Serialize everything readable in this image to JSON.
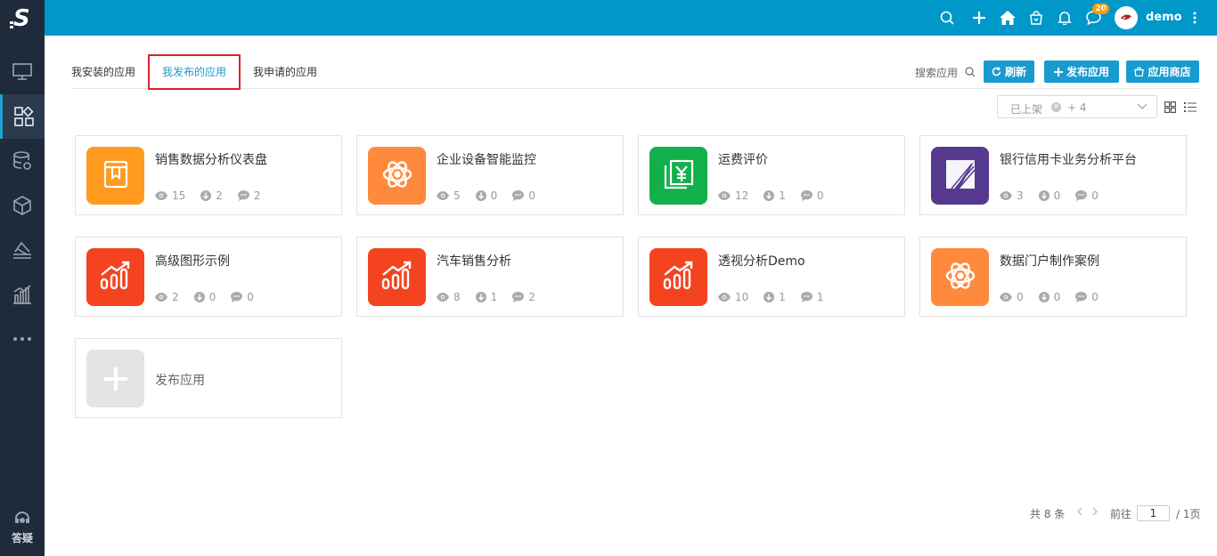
{
  "sidebar": {
    "logo": "S",
    "items": [
      {
        "name": "monitor-icon",
        "active": false
      },
      {
        "name": "apps-icon",
        "active": true
      },
      {
        "name": "database-settings-icon",
        "active": false
      },
      {
        "name": "cube-icon",
        "active": false
      },
      {
        "name": "layers-icon",
        "active": false
      },
      {
        "name": "bar-chart-icon",
        "active": false
      },
      {
        "name": "more-icon",
        "active": false
      }
    ],
    "help_label": "答疑"
  },
  "topbar": {
    "notification_count": "20",
    "username": "demo"
  },
  "tabs": {
    "installed": "我安装的应用",
    "published": "我发布的应用",
    "applied": "我申请的应用"
  },
  "toolbar": {
    "search_label": "搜索应用",
    "refresh": "刷新",
    "publish": "发布应用",
    "store": "应用商店"
  },
  "filter": {
    "tag": "已上架",
    "more": "+ 4"
  },
  "apps": [
    {
      "title": "销售数据分析仪表盘",
      "views": "15",
      "downloads": "2",
      "comments": "2",
      "color": "#ff9a1f",
      "icon": "book-icon"
    },
    {
      "title": "企业设备智能监控",
      "views": "5",
      "downloads": "0",
      "comments": "0",
      "color": "#ff8a3d",
      "icon": "atom-icon"
    },
    {
      "title": "运费评价",
      "views": "12",
      "downloads": "1",
      "comments": "0",
      "color": "#12b04a",
      "icon": "yuan-icon"
    },
    {
      "title": "银行信用卡业务分析平台",
      "views": "3",
      "downloads": "0",
      "comments": "0",
      "color": "#55398e",
      "icon": "stripe-z-icon"
    },
    {
      "title": "高级图形示例",
      "views": "2",
      "downloads": "0",
      "comments": "0",
      "color": "#f4431f",
      "icon": "growth-chart-icon"
    },
    {
      "title": "汽车销售分析",
      "views": "8",
      "downloads": "1",
      "comments": "2",
      "color": "#f4431f",
      "icon": "growth-chart-icon"
    },
    {
      "title": "透视分析Demo",
      "views": "10",
      "downloads": "1",
      "comments": "1",
      "color": "#f4431f",
      "icon": "growth-chart-icon"
    },
    {
      "title": "数据门户制作案例",
      "views": "0",
      "downloads": "0",
      "comments": "0",
      "color": "#ff8a3d",
      "icon": "atom-icon"
    }
  ],
  "add_card": {
    "label": "发布应用"
  },
  "pagination": {
    "total": "共 8 条",
    "goto_label": "前往",
    "page": "1",
    "pages": "/ 1页"
  }
}
